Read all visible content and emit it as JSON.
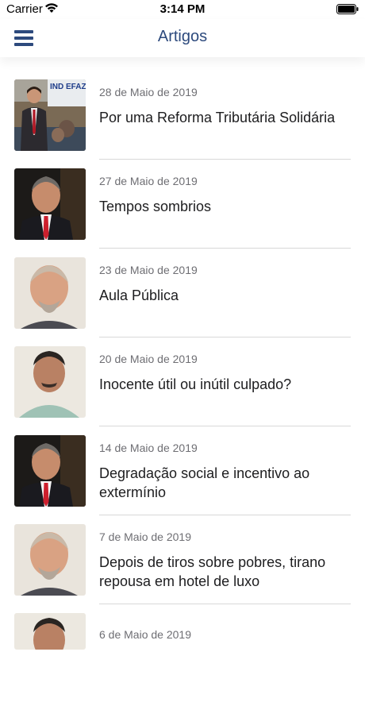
{
  "status_bar": {
    "carrier": "Carrier",
    "time": "3:14 PM"
  },
  "nav": {
    "title": "Artigos"
  },
  "articles": [
    {
      "date": "28 de Maio de 2019",
      "title": "Por uma Reforma Tributária Solidária"
    },
    {
      "date": "27 de Maio de 2019",
      "title": "Tempos sombrios"
    },
    {
      "date": "23 de Maio de 2019",
      "title": "Aula Pública"
    },
    {
      "date": "20 de Maio de 2019",
      "title": "Inocente útil ou inútil culpado?"
    },
    {
      "date": "14 de Maio de 2019",
      "title": "Degradação social e incentivo ao extermínio"
    },
    {
      "date": "7 de Maio de 2019",
      "title": "Depois de tiros sobre pobres, tirano repousa em hotel de luxo"
    },
    {
      "date": "6 de Maio de 2019",
      "title": ""
    }
  ],
  "thumbnail_art": {
    "banner_text": "IND EFAZ"
  },
  "colors": {
    "accent": "#2d4a7d",
    "tie_red": "#cc1f2d",
    "divider": "#d8d8d8"
  }
}
